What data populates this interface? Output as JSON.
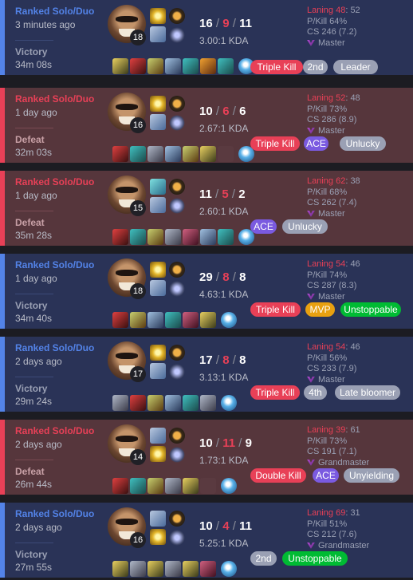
{
  "colors": {
    "win_accent": "#5383e8",
    "loss_accent": "#e84057",
    "win_bg": "#2a3357",
    "loss_bg": "#56363c"
  },
  "matches": [
    {
      "queue": "Ranked Solo/Duo",
      "time_ago": "3 minutes ago",
      "result": "Victory",
      "duration": "34m 08s",
      "level": "18",
      "kills": "16",
      "deaths": "9",
      "assists": "11",
      "kda_ratio": "3.00:1 KDA",
      "laning_label": "Laning 48",
      "laning_opp": ": 52",
      "pkill": "P/Kill 64%",
      "cs": "CS 246 (7.2)",
      "tier": "Master",
      "spells": [
        "flash",
        "ghost"
      ],
      "badges": [
        "Triple Kill",
        "2nd",
        "Leader"
      ]
    },
    {
      "queue": "Ranked Solo/Duo",
      "time_ago": "1 day ago",
      "result": "Defeat",
      "duration": "32m 03s",
      "level": "16",
      "kills": "10",
      "deaths": "6",
      "assists": "6",
      "kda_ratio": "2.67:1 KDA",
      "laning_label": "Laning 52",
      "laning_opp": ": 48",
      "pkill": "P/Kill 73%",
      "cs": "CS 286 (8.9)",
      "tier": "Master",
      "spells": [
        "flash",
        "ghost"
      ],
      "badges": [
        "Triple Kill",
        "ACE",
        "Unlucky"
      ]
    },
    {
      "queue": "Ranked Solo/Duo",
      "time_ago": "1 day ago",
      "result": "Defeat",
      "duration": "35m 28s",
      "level": "15",
      "kills": "11",
      "deaths": "5",
      "assists": "2",
      "kda_ratio": "2.60:1 KDA",
      "laning_label": "Laning 62",
      "laning_opp": ": 38",
      "pkill": "P/Kill 68%",
      "cs": "CS 262 (7.4)",
      "tier": "Master",
      "spells": [
        "teleport",
        "ghost"
      ],
      "badges": [
        "ACE",
        "Unlucky"
      ]
    },
    {
      "queue": "Ranked Solo/Duo",
      "time_ago": "1 day ago",
      "result": "Victory",
      "duration": "34m 40s",
      "level": "18",
      "kills": "29",
      "deaths": "8",
      "assists": "8",
      "kda_ratio": "4.63:1 KDA",
      "laning_label": "Laning 54",
      "laning_opp": ": 46",
      "pkill": "P/Kill 74%",
      "cs": "CS 287 (8.3)",
      "tier": "Master",
      "spells": [
        "flash",
        "ghost"
      ],
      "badges": [
        "Triple Kill",
        "MVP",
        "Unstoppable"
      ]
    },
    {
      "queue": "Ranked Solo/Duo",
      "time_ago": "2 days ago",
      "result": "Victory",
      "duration": "29m 24s",
      "level": "17",
      "kills": "17",
      "deaths": "8",
      "assists": "8",
      "kda_ratio": "3.13:1 KDA",
      "laning_label": "Laning 54",
      "laning_opp": ": 46",
      "pkill": "P/Kill 56%",
      "cs": "CS 233 (7.9)",
      "tier": "Master",
      "spells": [
        "flash",
        "ghost"
      ],
      "badges": [
        "Triple Kill",
        "4th",
        "Late bloomer"
      ]
    },
    {
      "queue": "Ranked Solo/Duo",
      "time_ago": "2 days ago",
      "result": "Defeat",
      "duration": "26m 44s",
      "level": "14",
      "kills": "10",
      "deaths": "11",
      "assists": "9",
      "kda_ratio": "1.73:1 KDA",
      "laning_label": "Laning 39",
      "laning_opp": ": 61",
      "pkill": "P/Kill 73%",
      "cs": "CS 191 (7.1)",
      "tier": "Grandmaster",
      "spells": [
        "ghost",
        "flash"
      ],
      "badges": [
        "Double Kill",
        "ACE",
        "Unyielding"
      ]
    },
    {
      "queue": "Ranked Solo/Duo",
      "time_ago": "2 days ago",
      "result": "Victory",
      "duration": "27m 55s",
      "level": "16",
      "kills": "10",
      "deaths": "4",
      "assists": "11",
      "kda_ratio": "5.25:1 KDA",
      "laning_label": "Laning 69",
      "laning_opp": ": 31",
      "pkill": "P/Kill 51%",
      "cs": "CS 212 (7.6)",
      "tier": "Grandmaster",
      "spells": [
        "ghost",
        "flash"
      ],
      "badges": [
        "2nd",
        "Unstoppable"
      ]
    }
  ]
}
